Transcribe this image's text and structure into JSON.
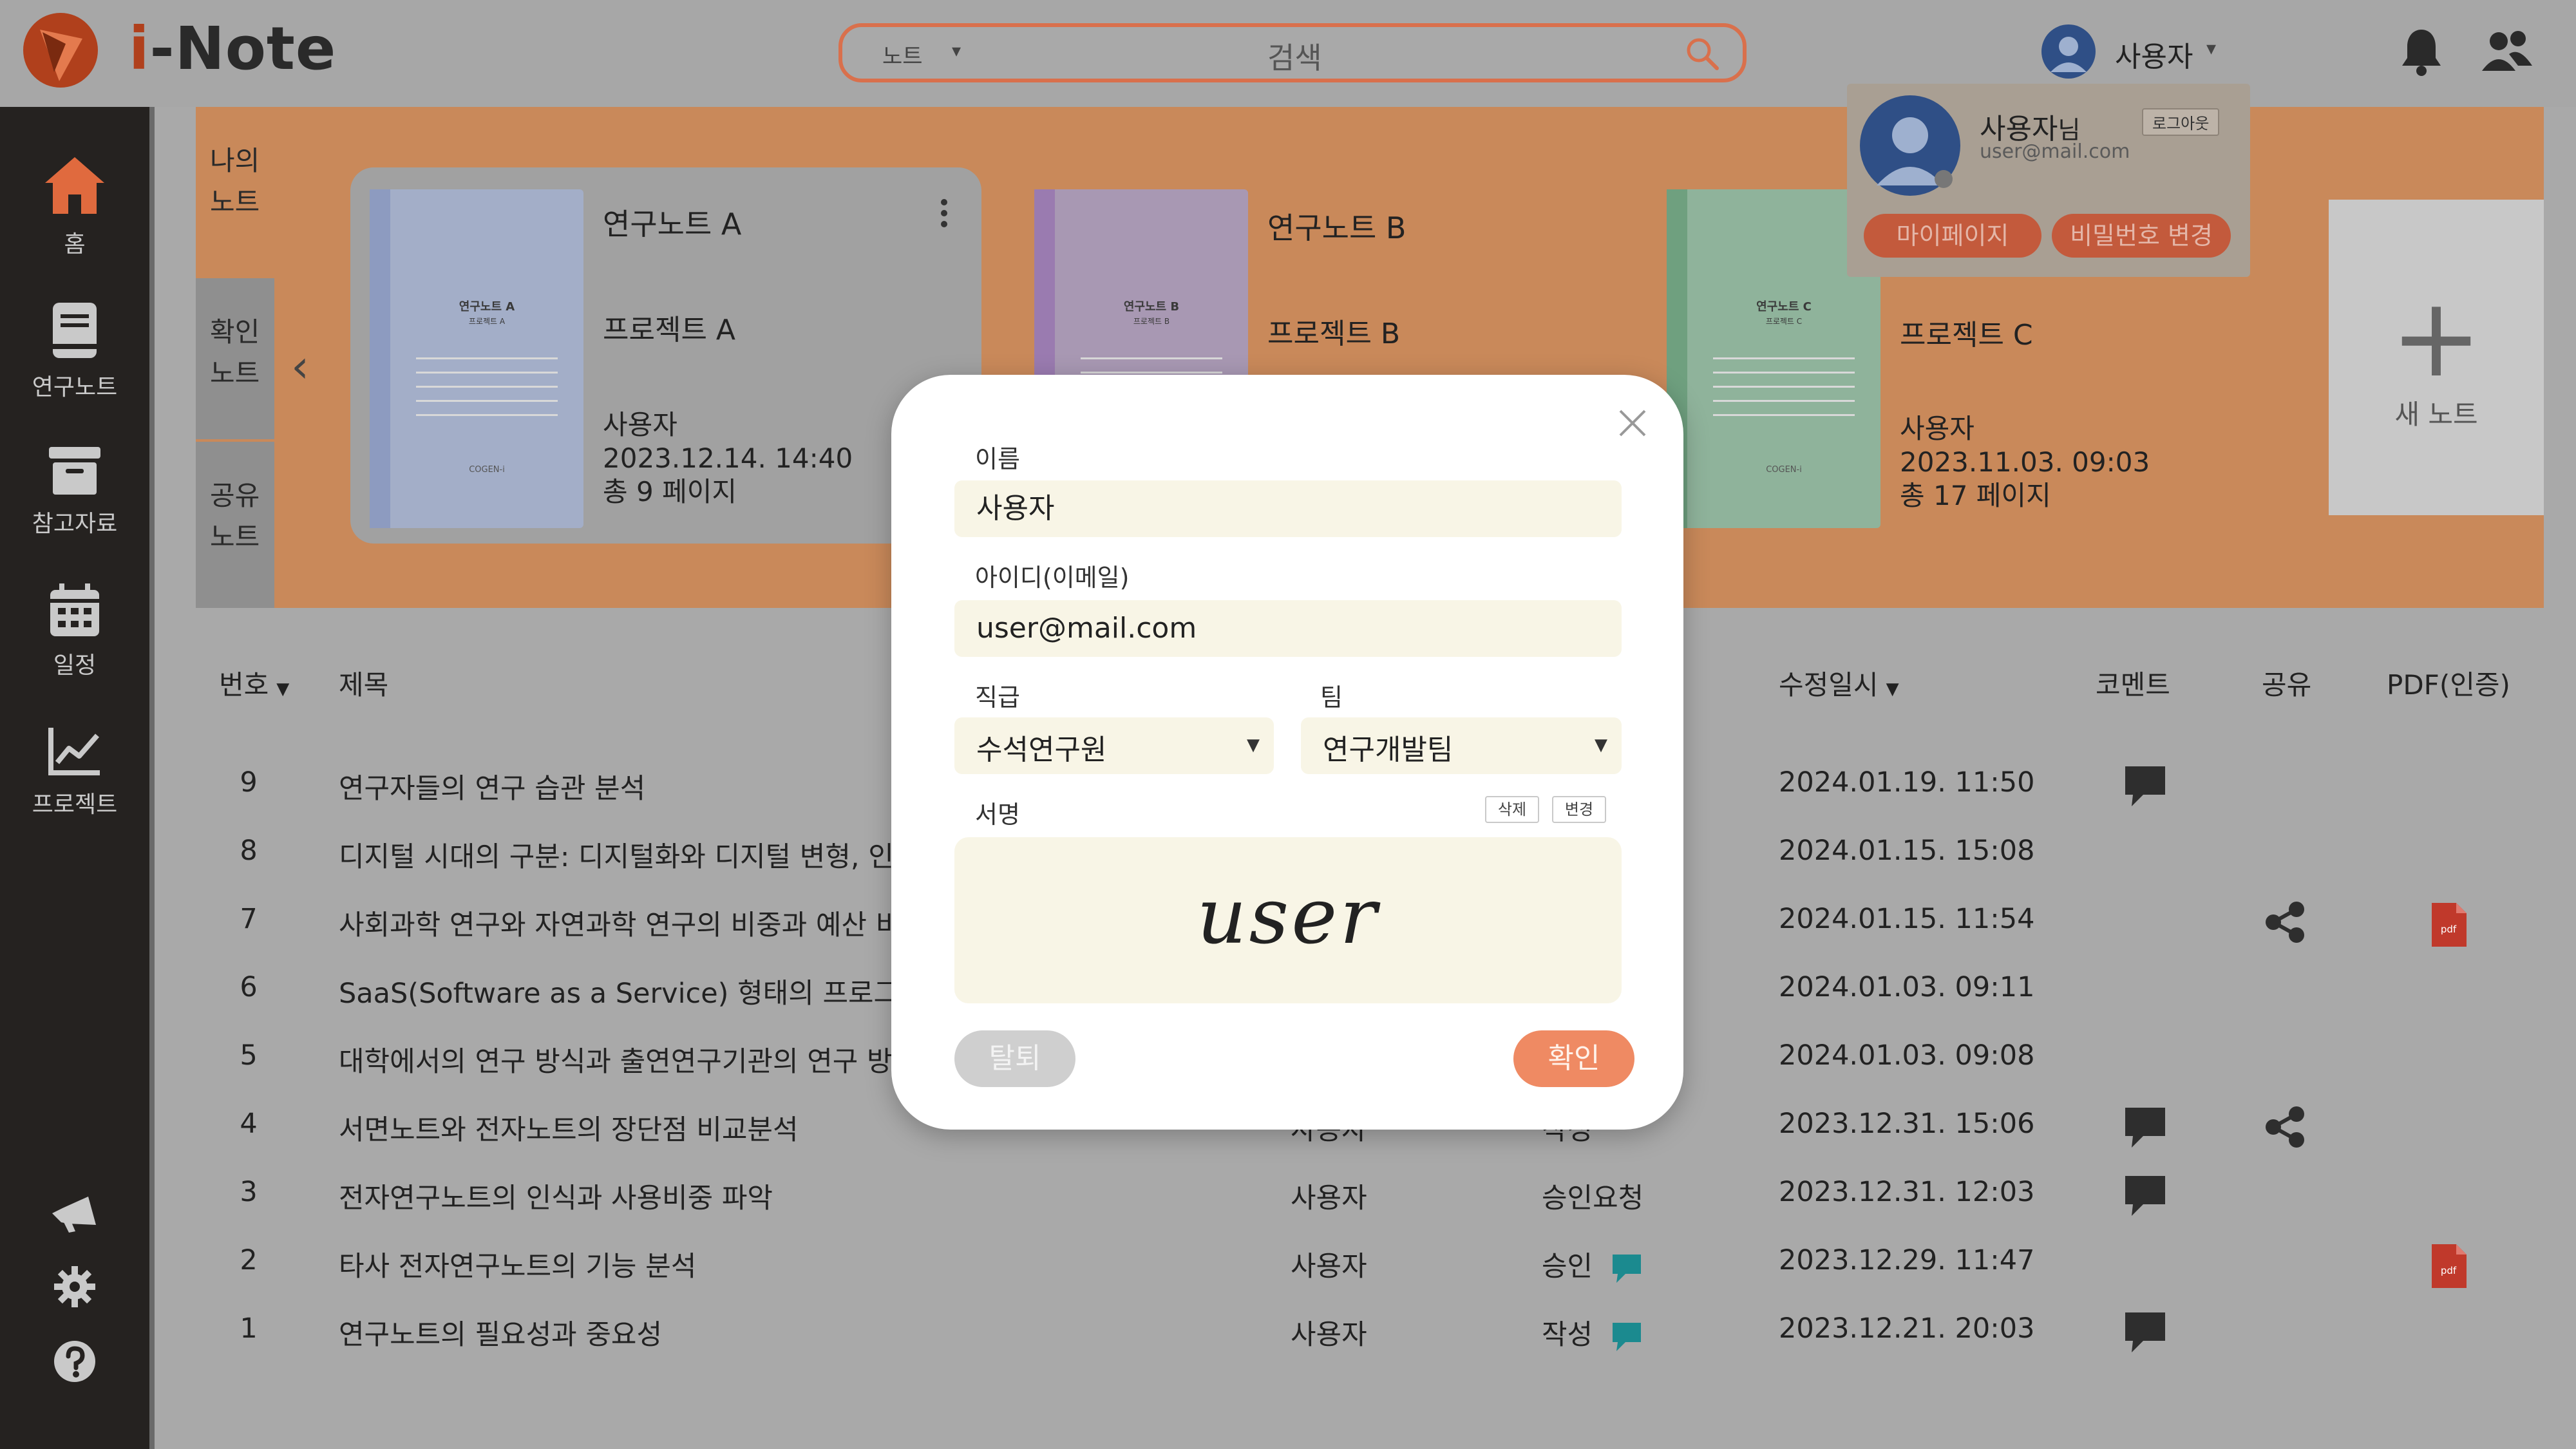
{
  "app": {
    "name": "i-Note",
    "name_prefix": "i",
    "name_rest": "-Note"
  },
  "colors": {
    "accent": "#ef8a63",
    "brand_dark": "#b0401c",
    "sidebar": "#252220",
    "hero": "#c9895a",
    "comment_teal": "#1b8a8f",
    "pdf_red": "#c0392b"
  },
  "search": {
    "scope": "노트",
    "placeholder": "검색"
  },
  "header": {
    "user_name": "사용자"
  },
  "sidebar": {
    "items": [
      {
        "label": "홈",
        "icon": "home-icon"
      },
      {
        "label": "연구노트",
        "icon": "book-icon"
      },
      {
        "label": "참고자료",
        "icon": "archive-icon"
      },
      {
        "label": "일정",
        "icon": "calendar-icon"
      },
      {
        "label": "프로젝트",
        "icon": "chart-line-icon"
      }
    ],
    "bottom_icons": [
      "megaphone-icon",
      "gear-icon",
      "help-icon"
    ]
  },
  "hero": {
    "tabs": [
      {
        "line1": "나의",
        "line2": "노트"
      },
      {
        "line1": "확인",
        "line2": "노트"
      },
      {
        "line1": "공유",
        "line2": "노트"
      }
    ],
    "notes": [
      {
        "title": "연구노트 A",
        "project": "프로젝트 A",
        "author": "사용자",
        "date": "2023.12.14.  14:40",
        "pages": "총 9 페이지",
        "cover_title": "연구노트 A",
        "cover_sub": "프로젝트 A",
        "cover_brand": "COGEN-i",
        "cover_color": "#a3aec8",
        "spine_color": "#8d9bc0"
      },
      {
        "title": "연구노트 B",
        "project": "프로젝트 B",
        "cover_title": "연구노트 B",
        "cover_sub": "프로젝트 B",
        "cover_color": "#a898b3",
        "spine_color": "#9a7bb0"
      },
      {
        "title": "",
        "project": "프로젝트 C",
        "author": "사용자",
        "date": "2023.11.03.  09:03",
        "pages": "총 17 페이지",
        "cover_title": "연구노트 C",
        "cover_sub": "프로젝트 C",
        "cover_brand": "COGEN-i",
        "cover_color": "#8fb39b",
        "spine_color": "#6fa07f"
      }
    ],
    "new_note_label": "새 노트"
  },
  "user_popup": {
    "name": "사용자",
    "name_suffix": "님",
    "email": "user@mail.com",
    "logout_label": "로그아웃",
    "mypage_label": "마이페이지",
    "change_pw_label": "비밀번호 변경"
  },
  "table": {
    "headers": {
      "num": "번호",
      "title": "제목",
      "modified": "수정일시",
      "comment": "코멘트",
      "share": "공유",
      "pdf": "PDF(인증)"
    },
    "rows": [
      {
        "num": "9",
        "title": "연구자들의 연구 습관 분석",
        "author": "",
        "status": "",
        "date": "2024.01.19. 11:50",
        "comment": true,
        "share": false,
        "pdf": false,
        "status_chat": false
      },
      {
        "num": "8",
        "title": "디지털 시대의 구분: 디지털화와 디지털 변형, 인터",
        "author": "",
        "status": "",
        "date": "2024.01.15. 15:08",
        "comment": false,
        "share": false,
        "pdf": false,
        "status_chat": false
      },
      {
        "num": "7",
        "title": "사회과학 연구와 자연과학 연구의 비중과 예산 비교",
        "author": "",
        "status": "",
        "date": "2024.01.15. 11:54",
        "comment": false,
        "share": true,
        "pdf": true,
        "status_chat": false
      },
      {
        "num": "6",
        "title": "SaaS(Software as a Service) 형태의 프로그램",
        "author": "",
        "status": "",
        "date": "2024.01.03. 09:11",
        "comment": false,
        "share": false,
        "pdf": false,
        "status_chat": false
      },
      {
        "num": "5",
        "title": "대학에서의 연구 방식과 출연연구기관의 연구 방식",
        "author": "",
        "status": "",
        "date": "2024.01.03. 09:08",
        "comment": false,
        "share": false,
        "pdf": false,
        "status_chat": false
      },
      {
        "num": "4",
        "title": "서면노트와 전자노트의 장단점 비교분석",
        "author": "사용자",
        "status": "작성",
        "date": "2023.12.31. 15:06",
        "comment": true,
        "share": true,
        "pdf": false,
        "status_chat": false
      },
      {
        "num": "3",
        "title": "전자연구노트의 인식과 사용비중 파악",
        "author": "사용자",
        "status": "승인요청",
        "date": "2023.12.31. 12:03",
        "comment": true,
        "share": false,
        "pdf": false,
        "status_chat": false
      },
      {
        "num": "2",
        "title": "타사 전자연구노트의 기능 분석",
        "author": "사용자",
        "status": "승인",
        "date": "2023.12.29. 11:47",
        "comment": false,
        "share": false,
        "pdf": true,
        "status_chat": true
      },
      {
        "num": "1",
        "title": "연구노트의 필요성과 중요성",
        "author": "사용자",
        "status": "작성",
        "date": "2023.12.21. 20:03",
        "comment": true,
        "share": false,
        "pdf": false,
        "status_chat": true
      }
    ],
    "pdf_badge": "pdf"
  },
  "modal": {
    "name_label": "이름",
    "name_value": "사용자",
    "id_label": "아이디(이메일)",
    "id_value": "user@mail.com",
    "position_label": "직급",
    "position_value": "수석연구원",
    "team_label": "팀",
    "team_value": "연구개발팀",
    "signature_label": "서명",
    "delete_label": "삭제",
    "change_label": "변경",
    "signature_text": "user",
    "withdraw_label": "탈퇴",
    "confirm_label": "확인"
  }
}
